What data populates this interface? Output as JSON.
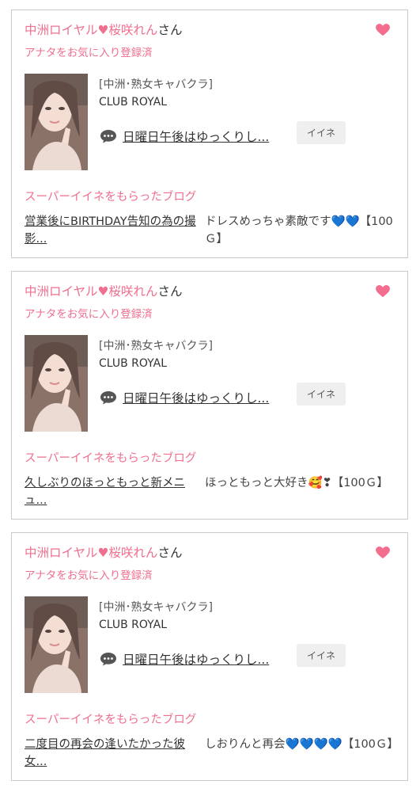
{
  "cards": [
    {
      "name": "中洲ロイヤル♥桜咲れん",
      "honorific": "さん",
      "favorite_note": "アナタをお気に入り登録済",
      "shop_category": "[中洲･熟女キャバクラ]",
      "shop_name": "CLUB ROYAL",
      "blog_title": "日曜日午後はゆっくりし...",
      "iine_label": "イイネ",
      "section_label": "スーパーイイネをもらったブログ",
      "post_title": "営業後にBIRTHDAY告知の為の撮影...",
      "comment": "ドレスめっちゃ素敵です💙💙【100Ｇ】"
    },
    {
      "name": "中洲ロイヤル♥桜咲れん",
      "honorific": "さん",
      "favorite_note": "アナタをお気に入り登録済",
      "shop_category": "[中洲･熟女キャバクラ]",
      "shop_name": "CLUB ROYAL",
      "blog_title": "日曜日午後はゆっくりし...",
      "iine_label": "イイネ",
      "section_label": "スーパーイイネをもらったブログ",
      "post_title": "久しぶりのほっともっと新メニュ...",
      "comment": "ほっともっと大好き🥰❣【100Ｇ】"
    },
    {
      "name": "中洲ロイヤル♥桜咲れん",
      "honorific": "さん",
      "favorite_note": "アナタをお気に入り登録済",
      "shop_category": "[中洲･熟女キャバクラ]",
      "shop_name": "CLUB ROYAL",
      "blog_title": "日曜日午後はゆっくりし...",
      "iine_label": "イイネ",
      "section_label": "スーパーイイネをもらったブログ",
      "post_title": "二度目の再会の逢いたかった彼女...",
      "comment": "しおりんと再会💙💙💙💙【100Ｇ】"
    }
  ],
  "colors": {
    "accent_pink": "#ef6f8e",
    "heart_pink": "#f36d8f",
    "border": "#c9c9c9",
    "button_bg": "#efefef"
  },
  "icons": [
    "heart-icon",
    "chat-bubble-icon"
  ]
}
